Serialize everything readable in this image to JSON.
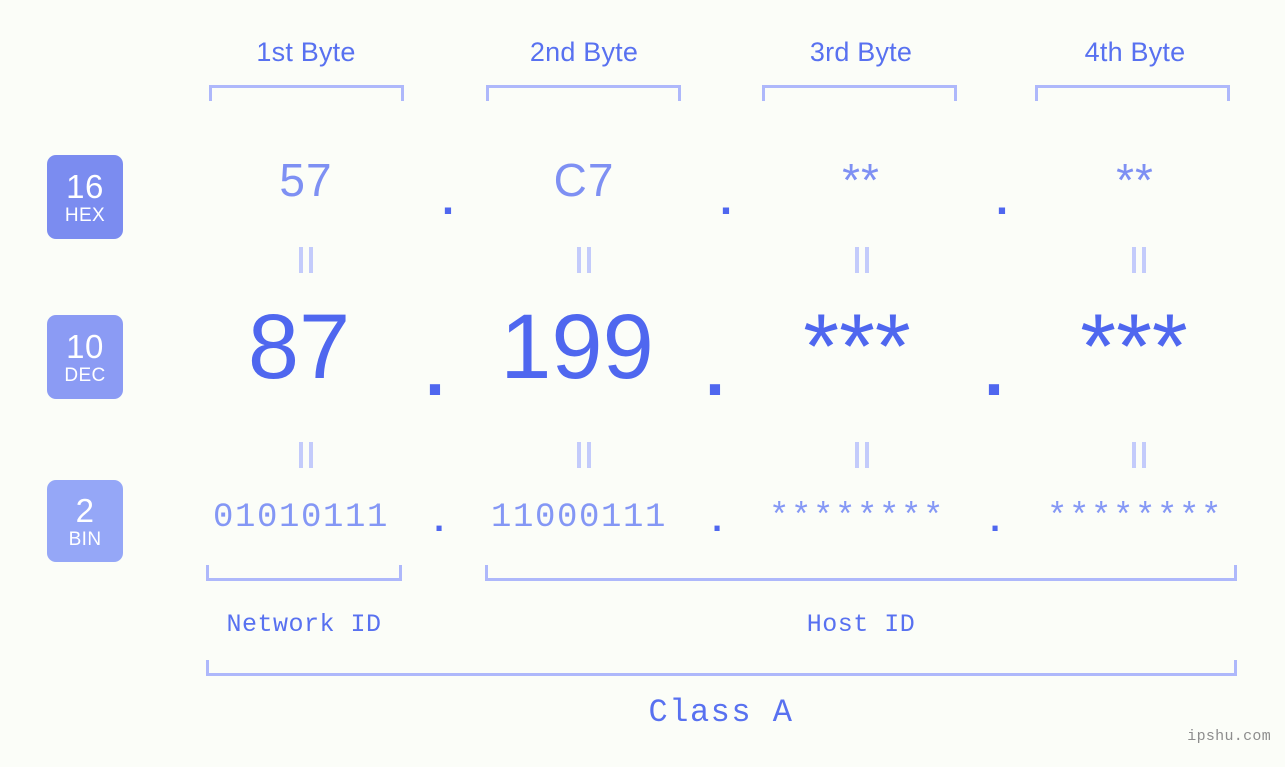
{
  "background_color": "#fbfdf8",
  "accent_colors": {
    "strong_blue": "#4f67ef",
    "mid_blue": "#5871f0",
    "light_blue": "#8497f5",
    "pale_blue": "#aeb8fb",
    "badge_hex": "#7b8cf0",
    "badge_dec": "#8b9bf4",
    "badge_bin": "#95a7f7"
  },
  "header": {
    "byte_labels": [
      "1st Byte",
      "2nd Byte",
      "3rd Byte",
      "4th Byte"
    ]
  },
  "bases": [
    {
      "number": "16",
      "name": "HEX"
    },
    {
      "number": "10",
      "name": "DEC"
    },
    {
      "number": "2",
      "name": "BIN"
    }
  ],
  "separator": ".",
  "rows": {
    "hex": {
      "base_number": "16",
      "base_name": "HEX",
      "octets": [
        "57",
        "C7",
        "**",
        "**"
      ]
    },
    "dec": {
      "base_number": "10",
      "base_name": "DEC",
      "octets": [
        "87",
        "199",
        "***",
        "***"
      ]
    },
    "bin": {
      "base_number": "2",
      "base_name": "BIN",
      "octets": [
        "01010111",
        "11000111",
        "********",
        "********"
      ]
    }
  },
  "equals_marker": "=",
  "sections": {
    "network_id_label": "Network ID",
    "host_id_label": "Host ID",
    "class_label": "Class A"
  },
  "watermark": "ipshu.com"
}
